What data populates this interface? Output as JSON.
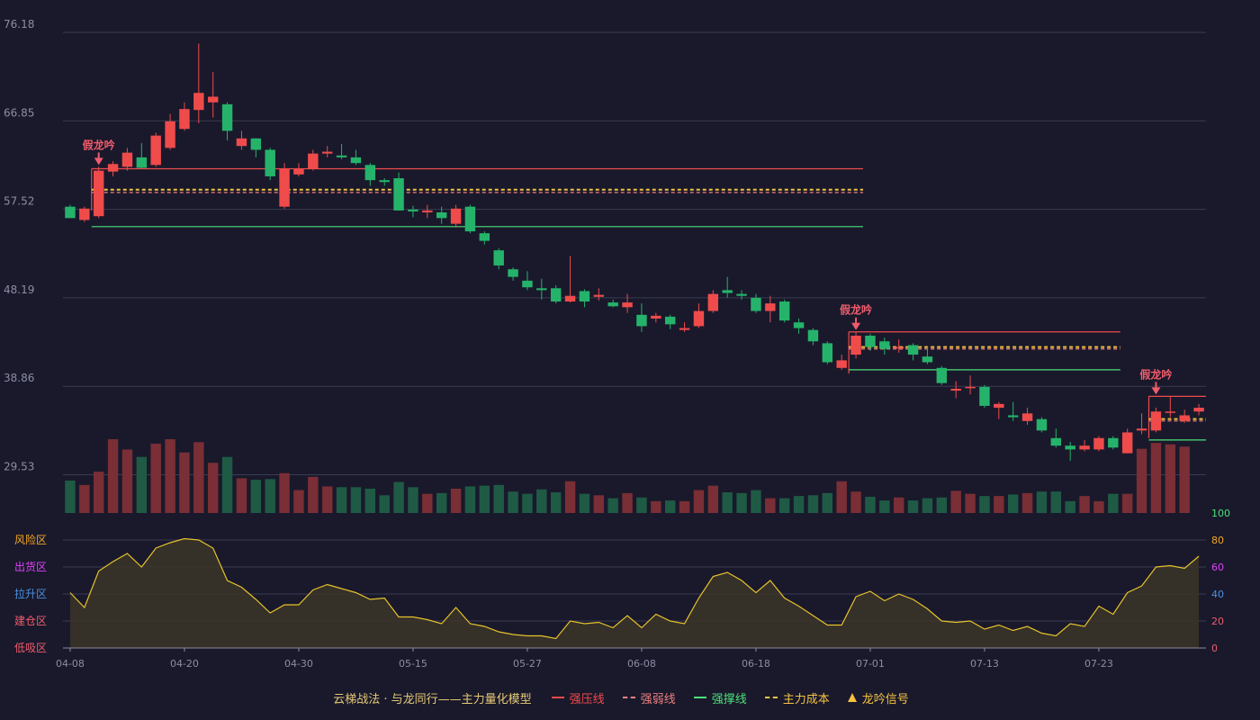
{
  "colors": {
    "bg": "#19192b",
    "up": "#ef4b4b",
    "down": "#25b36b",
    "volUp": "#7a2e35",
    "volDown": "#1f5a45",
    "grid": "#3a3a52",
    "axis": "#8c8ca5",
    "riskLine": "#e6c22b",
    "pressure": "#ef4b4b",
    "weak": "#f08080",
    "support": "#4ee07a",
    "cost": "#f5c242",
    "signal": "#ef5c6c"
  },
  "legend": {
    "title": "云梯战法 · 与龙同行——主力量化模型",
    "items": [
      {
        "label": "强压线",
        "style": "solid",
        "color": "#ef4b4b"
      },
      {
        "label": "强弱线",
        "style": "dashed",
        "color": "#f08080"
      },
      {
        "label": "强撑线",
        "style": "solid",
        "color": "#4ee07a"
      },
      {
        "label": "主力成本",
        "style": "dashed",
        "color": "#f5c242"
      },
      {
        "label": "龙吟信号",
        "style": "triangle",
        "color": "#f5c242"
      }
    ]
  },
  "chart_data": {
    "type": "candlestick",
    "price_axis": {
      "ticks": [
        "76.18",
        "66.85",
        "57.52",
        "48.19",
        "38.86",
        "29.53"
      ],
      "range": [
        25.5,
        76.18
      ]
    },
    "x_axis": {
      "ticks": [
        {
          "label": "04-08",
          "index": 0
        },
        {
          "label": "04-20",
          "index": 8
        },
        {
          "label": "04-30",
          "index": 16
        },
        {
          "label": "05-15",
          "index": 24
        },
        {
          "label": "05-27",
          "index": 32
        },
        {
          "label": "06-08",
          "index": 40
        },
        {
          "label": "06-18",
          "index": 48
        },
        {
          "label": "07-01",
          "index": 56
        },
        {
          "label": "07-13",
          "index": 64
        },
        {
          "label": "07-23",
          "index": 72
        }
      ]
    },
    "candles": [
      [
        57.8,
        56.6,
        58.0,
        56.6
      ],
      [
        56.4,
        57.6,
        57.8,
        56.2
      ],
      [
        56.8,
        61.6,
        62.0,
        56.6
      ],
      [
        61.5,
        62.3,
        62.6,
        61.0
      ],
      [
        62.0,
        63.5,
        64.0,
        61.6
      ],
      [
        63.0,
        61.9,
        64.5,
        61.8
      ],
      [
        62.2,
        65.3,
        65.6,
        62.0
      ],
      [
        64.0,
        66.8,
        67.6,
        63.8
      ],
      [
        66.0,
        68.1,
        68.8,
        65.8
      ],
      [
        68.0,
        69.8,
        75.0,
        66.6
      ],
      [
        68.8,
        69.4,
        72.0,
        67.2
      ],
      [
        68.6,
        65.8,
        68.8,
        64.8
      ],
      [
        64.2,
        65.0,
        65.8,
        63.8
      ],
      [
        65.0,
        63.8,
        65.0,
        63.0
      ],
      [
        63.8,
        61.0,
        64.0,
        60.6
      ],
      [
        57.8,
        61.8,
        62.4,
        57.6
      ],
      [
        61.2,
        61.8,
        62.4,
        61.0
      ],
      [
        61.8,
        63.4,
        63.8,
        61.6
      ],
      [
        63.4,
        63.6,
        64.2,
        63.0
      ],
      [
        63.2,
        63.0,
        64.4,
        62.8
      ],
      [
        63.0,
        62.4,
        63.8,
        62.2
      ],
      [
        62.2,
        60.6,
        62.4,
        60.0
      ],
      [
        60.6,
        60.4,
        60.8,
        60.0
      ],
      [
        60.8,
        57.4,
        61.4,
        57.4
      ],
      [
        57.5,
        57.3,
        57.9,
        56.7
      ],
      [
        57.2,
        57.4,
        58.0,
        56.6
      ],
      [
        57.2,
        56.6,
        57.8,
        56.0
      ],
      [
        56.0,
        57.6,
        58.0,
        55.6
      ],
      [
        57.8,
        55.2,
        58.0,
        55.0
      ],
      [
        55.0,
        54.2,
        55.2,
        53.8
      ],
      [
        53.2,
        51.6,
        53.4,
        51.2
      ],
      [
        51.2,
        50.4,
        51.4,
        50.0
      ],
      [
        50.0,
        49.3,
        51.0,
        49.0
      ],
      [
        49.2,
        49.0,
        50.2,
        48.0
      ],
      [
        49.2,
        47.8,
        49.5,
        47.6
      ],
      [
        47.8,
        48.4,
        52.6,
        47.7
      ],
      [
        48.9,
        47.8,
        49.1,
        47.2
      ],
      [
        48.3,
        48.5,
        49.2,
        47.9
      ],
      [
        47.7,
        47.3,
        48.0,
        47.2
      ],
      [
        47.2,
        47.7,
        48.6,
        46.6
      ],
      [
        46.4,
        45.2,
        47.6,
        44.6
      ],
      [
        46.0,
        46.3,
        46.6,
        45.6
      ],
      [
        46.2,
        45.4,
        46.4,
        44.9
      ],
      [
        44.8,
        45.0,
        45.6,
        44.6
      ],
      [
        45.2,
        46.8,
        47.6,
        45.0
      ],
      [
        46.8,
        48.6,
        49.0,
        46.6
      ],
      [
        49.0,
        48.7,
        50.4,
        48.2
      ],
      [
        48.6,
        48.4,
        49.0,
        48.0
      ],
      [
        48.2,
        46.8,
        48.6,
        46.6
      ],
      [
        46.8,
        47.6,
        48.4,
        45.6
      ],
      [
        47.8,
        45.8,
        48.0,
        45.6
      ],
      [
        45.6,
        45.0,
        46.0,
        44.4
      ],
      [
        44.8,
        43.6,
        45.0,
        43.2
      ],
      [
        43.4,
        41.4,
        43.6,
        41.2
      ],
      [
        40.8,
        41.6,
        42.2,
        40.6
      ],
      [
        42.2,
        44.2,
        44.6,
        41.8
      ],
      [
        44.2,
        43.0,
        44.4,
        42.6
      ],
      [
        43.6,
        42.8,
        44.0,
        42.2
      ],
      [
        43.0,
        43.0,
        43.8,
        42.4
      ],
      [
        43.2,
        42.2,
        43.4,
        41.6
      ],
      [
        42.0,
        41.4,
        43.0,
        41.2
      ],
      [
        40.8,
        39.2,
        41.0,
        39.0
      ],
      [
        38.4,
        38.6,
        39.4,
        37.6
      ],
      [
        38.8,
        38.8,
        40.0,
        38.0
      ],
      [
        38.8,
        36.8,
        39.0,
        36.6
      ],
      [
        36.6,
        37.0,
        37.2,
        35.4
      ],
      [
        35.8,
        35.6,
        37.2,
        35.2
      ],
      [
        35.2,
        36.0,
        36.6,
        34.8
      ],
      [
        35.4,
        34.2,
        35.6,
        34.0
      ],
      [
        33.4,
        32.6,
        34.4,
        32.4
      ],
      [
        32.6,
        32.2,
        33.0,
        31.0
      ],
      [
        32.2,
        32.6,
        33.2,
        32.0
      ],
      [
        32.2,
        33.4,
        33.6,
        32.0
      ],
      [
        33.4,
        32.4,
        33.6,
        32.2
      ],
      [
        31.8,
        34.0,
        34.4,
        31.8
      ],
      [
        34.2,
        34.4,
        36.0,
        33.8
      ],
      [
        34.2,
        36.2,
        36.6,
        34.0
      ],
      [
        36.2,
        36.2,
        37.8,
        35.6
      ],
      [
        35.2,
        35.8,
        36.4,
        35.0
      ],
      [
        36.2,
        36.6,
        37.0,
        35.8
      ]
    ],
    "volume_pct": [
      44,
      38,
      56,
      100,
      86,
      76,
      94,
      100,
      82,
      96,
      68,
      76,
      47,
      45,
      46,
      54,
      31,
      49,
      36,
      35,
      35,
      33,
      24,
      42,
      35,
      26,
      27,
      33,
      36,
      37,
      38,
      29,
      26,
      32,
      28,
      43,
      26,
      24,
      20,
      27,
      21,
      16,
      17,
      16,
      31,
      37,
      28,
      27,
      31,
      20,
      20,
      23,
      24,
      27,
      43,
      29,
      22,
      17,
      21,
      17,
      20,
      21,
      30,
      26,
      23,
      23,
      25,
      27,
      29,
      29,
      16,
      23,
      16,
      26,
      26,
      87,
      95,
      93,
      90
    ],
    "risk_indicator": {
      "name": "风险区间",
      "levels": [
        {
          "label": "风险区",
          "value": 80,
          "color": "#f5a623"
        },
        {
          "label": "出货区",
          "value": 60,
          "color": "#e040fb"
        },
        {
          "label": "拉升区",
          "value": 40,
          "color": "#4a90e2"
        },
        {
          "label": "建仓区",
          "value": 20,
          "color": "#ef5c6c"
        },
        {
          "label": "低吸区",
          "value": 0,
          "color": "#ef5c6c"
        }
      ],
      "right_ticks": [
        {
          "label": "100",
          "value": 100,
          "color": "#4ee07a"
        },
        {
          "label": "80",
          "value": 80,
          "color": "#f5a623"
        },
        {
          "label": "60",
          "value": 60,
          "color": "#e040fb"
        },
        {
          "label": "40",
          "value": 40,
          "color": "#4a90e2"
        },
        {
          "label": "20",
          "value": 20,
          "color": "#ef5c6c"
        },
        {
          "label": "0",
          "value": 0,
          "color": "#ef5c6c"
        }
      ],
      "values": [
        41,
        30,
        57,
        64,
        70,
        60,
        74,
        78,
        81,
        80,
        74,
        50,
        45,
        36,
        26,
        32,
        32,
        43,
        47,
        44,
        41,
        36,
        37,
        23,
        23,
        21,
        18,
        30,
        18,
        16,
        12,
        10,
        9,
        9,
        7,
        20,
        18,
        19,
        15,
        24,
        15,
        25,
        20,
        18,
        37,
        53,
        56,
        50,
        41,
        50,
        37,
        31,
        24,
        17,
        17,
        38,
        42,
        35,
        40,
        36,
        29,
        20,
        19,
        20,
        14,
        17,
        13,
        16,
        11,
        9,
        18,
        16,
        31,
        25,
        41,
        46,
        60,
        61,
        59,
        68
      ]
    },
    "levels": [
      {
        "kind": "pressure",
        "value": 61.8,
        "start": 2,
        "end": 55,
        "color": "#ef4b4b"
      },
      {
        "kind": "weak",
        "value": 59.3,
        "start": 2,
        "end": 55,
        "color": "#f08080"
      },
      {
        "kind": "cost",
        "value": 59.6,
        "start": 2,
        "end": 55,
        "color": "#f5c242"
      },
      {
        "kind": "support",
        "value": 55.7,
        "start": 2,
        "end": 55,
        "color": "#4ee07a"
      },
      {
        "kind": "pressure",
        "value": 44.6,
        "start": 55,
        "end": 73,
        "color": "#ef4b4b"
      },
      {
        "kind": "weak",
        "value": 42.8,
        "start": 55,
        "end": 73,
        "color": "#f08080"
      },
      {
        "kind": "cost",
        "value": 43.0,
        "start": 55,
        "end": 73,
        "color": "#f5c242"
      },
      {
        "kind": "support",
        "value": 40.6,
        "start": 55,
        "end": 73,
        "color": "#4ee07a"
      },
      {
        "kind": "pressure",
        "value": 37.8,
        "start": 76,
        "end": 79,
        "color": "#ef4b4b"
      },
      {
        "kind": "weak",
        "value": 35.2,
        "start": 76,
        "end": 79,
        "color": "#f08080"
      },
      {
        "kind": "cost",
        "value": 35.4,
        "start": 76,
        "end": 79,
        "color": "#f5c242"
      },
      {
        "kind": "support",
        "value": 33.2,
        "start": 76,
        "end": 79,
        "color": "#4ee07a"
      }
    ],
    "signals": [
      {
        "index": 2,
        "label": "假龙吟",
        "price": 62.0
      },
      {
        "index": 55,
        "label": "假龙吟",
        "price": 44.6
      },
      {
        "index": 76,
        "label": "假龙吟",
        "price": 37.8
      }
    ]
  }
}
